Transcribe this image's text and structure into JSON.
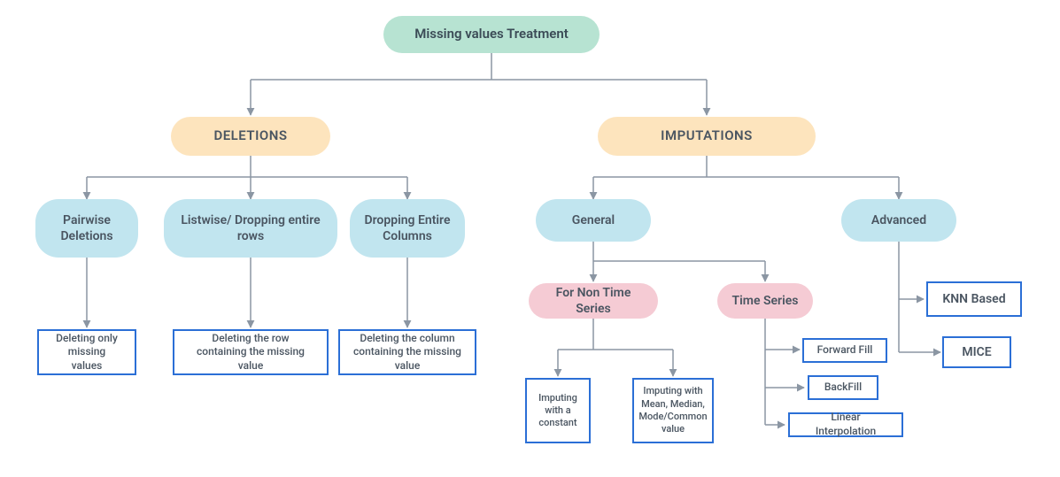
{
  "root": {
    "label": "Missing values Treatment"
  },
  "level1": {
    "deletions": "DELETIONS",
    "imputations": "IMPUTATIONS"
  },
  "deletions_children": {
    "pairwise": "Pairwise Deletions",
    "listwise": "Listwise/ Dropping entire rows",
    "dropcol": "Dropping Entire Columns"
  },
  "deletions_leaves": {
    "pairwise_desc": "Deleting only missing values",
    "listwise_desc": "Deleting the row containing the missing value",
    "dropcol_desc": "Deleting the column containing the missing value"
  },
  "imputations_children": {
    "general": "General",
    "advanced": "Advanced"
  },
  "general_children": {
    "non_ts": "For Non Time Series",
    "ts": "Time Series"
  },
  "non_ts_leaves": {
    "constant": "Imputing with a constant",
    "mmm": "Imputing with Mean, Median, Mode/Common value"
  },
  "ts_leaves": {
    "ffill": "Forward Fill",
    "bfill": "BackFill",
    "linterp": "Linear Interpolation"
  },
  "advanced_leaves": {
    "knn": "KNN Based",
    "mice": "MICE"
  }
}
